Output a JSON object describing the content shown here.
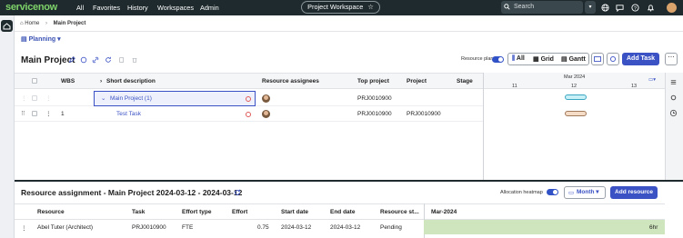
{
  "topnav": {
    "logo": "servicenow",
    "items": [
      "All",
      "Favorites",
      "History",
      "Workspaces",
      "Admin"
    ],
    "workspace_title": "Project Workspace",
    "search_placeholder": "Search"
  },
  "breadcrumb": {
    "home": "Home",
    "current": "Main Project"
  },
  "planning": {
    "label": "Planning"
  },
  "header": {
    "title": "Main Project",
    "resource_plan_label": "Resource plan",
    "views": [
      "All",
      "Grid",
      "Gantt"
    ],
    "add_task_label": "Add Task"
  },
  "grid": {
    "columns": [
      "WBS",
      "Short description",
      "Resource assignees",
      "Top project",
      "Project",
      "Stage"
    ],
    "rows": [
      {
        "wbs": "",
        "short_description": "Main Project (1)",
        "top_project": "PRJ0010900",
        "project": "",
        "stage": ""
      },
      {
        "wbs": "1",
        "short_description": "Test Task",
        "top_project": "PRJ0010900",
        "project": "PRJ0010900",
        "stage": ""
      }
    ]
  },
  "gantt": {
    "month": "Mar 2024",
    "days": [
      "11",
      "12",
      "13"
    ]
  },
  "resource_panel": {
    "title": "Resource assignment - Main Project 2024-03-12 - 2024-03-12",
    "allocation_heatmap_label": "Allocation heatmap",
    "month_label": "Month",
    "add_resource_label": "Add resource",
    "columns": [
      "Resource",
      "Task",
      "Effort type",
      "Effort",
      "Start date",
      "End date",
      "Resource st...",
      "Mar-2024"
    ],
    "rows": [
      {
        "resource": "Abel Tuter (Architect)",
        "task": "PRJ0010900",
        "effort_type": "FTE",
        "effort": "0.75",
        "start_date": "2024-03-12",
        "end_date": "2024-03-12",
        "status": "Pending",
        "heat": "6hr"
      }
    ]
  },
  "colors": {
    "nav_bg": "#1f2a2e",
    "accent": "#3b52c4",
    "logo_green": "#7ed36a",
    "heat_green": "#cfe5bd"
  }
}
